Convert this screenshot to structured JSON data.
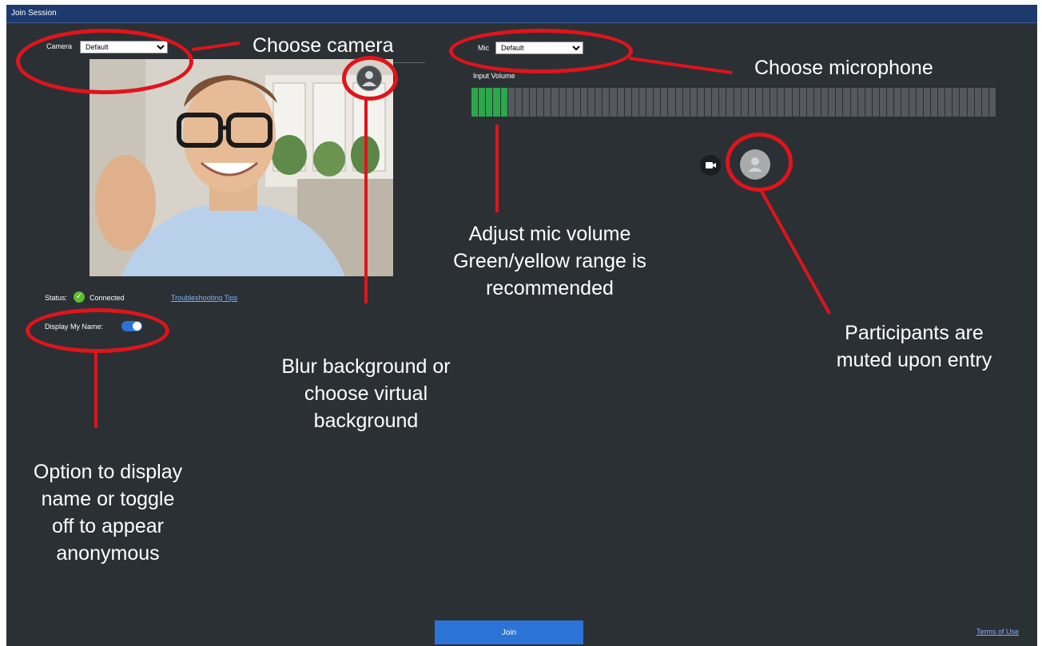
{
  "window": {
    "title": "Join Session"
  },
  "camera": {
    "label": "Camera",
    "selected": "Default"
  },
  "mic": {
    "label": "Mic",
    "selected": "Default",
    "input_volume_label": "Input Volume",
    "level_fraction": 0.07
  },
  "status": {
    "label": "Status:",
    "value": "Connected",
    "troubleshooting_link": "Troubleshooting Tips"
  },
  "display_name": {
    "label": "Display My Name:",
    "enabled": true
  },
  "footer": {
    "join_label": "Join",
    "terms_link": "Terms of Use"
  },
  "annotations": {
    "choose_camera": "Choose camera",
    "choose_microphone": "Choose microphone",
    "mic_volume": [
      "Adjust mic volume",
      "Green/yellow range is",
      "recommended"
    ],
    "muted": [
      "Participants are",
      "muted upon entry"
    ],
    "blur": [
      "Blur background or",
      "choose virtual",
      "background"
    ],
    "display_option": [
      "Option to display",
      "name or toggle",
      "off to appear",
      "anonymous"
    ]
  },
  "colors": {
    "accent": "#2b73d6",
    "annotation_red": "#e0141b",
    "meter_on": "#2ba84a",
    "titlebar": "#1e3a6c"
  }
}
